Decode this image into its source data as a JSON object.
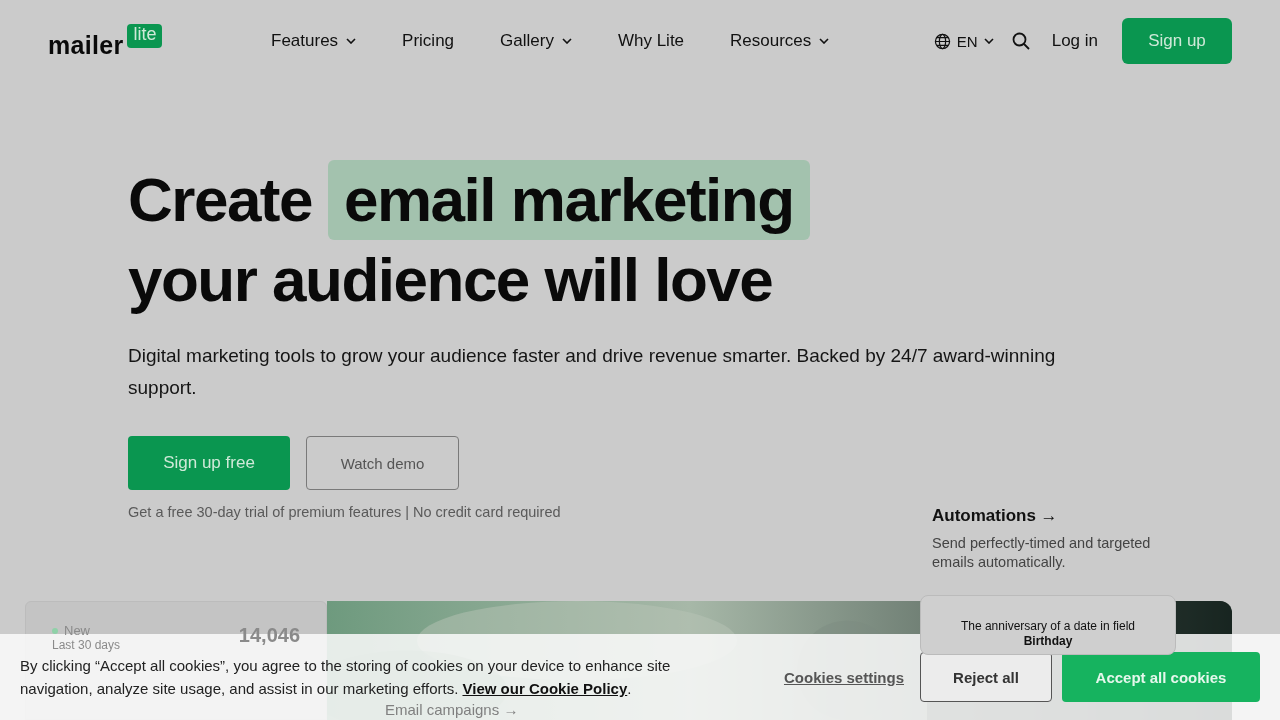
{
  "nav": {
    "logo": {
      "word": "mailer",
      "badge": "lite"
    },
    "items": [
      {
        "label": "Features",
        "dropdown": true
      },
      {
        "label": "Pricing",
        "dropdown": false
      },
      {
        "label": "Gallery",
        "dropdown": true
      },
      {
        "label": "Why Lite",
        "dropdown": false
      },
      {
        "label": "Resources",
        "dropdown": true
      }
    ],
    "language": "EN",
    "login": "Log in",
    "signup": "Sign up"
  },
  "hero": {
    "title_start": "Create",
    "title_highlight": "email marketing",
    "title_end": "your audience will love",
    "subtitle": "Digital marketing tools to grow your audience faster and drive revenue smarter. Backed by 24/7 award-winning support.",
    "primary_button": "Sign up free",
    "secondary_button": "Watch demo",
    "note": "Get a free 30-day trial of premium features | No credit card required"
  },
  "feature": {
    "title": "Automations →",
    "description": "Send perfectly-timed and targeted emails automatically."
  },
  "stats_card": {
    "label": "New",
    "period": "Last 30 days",
    "value": "14,046"
  },
  "showcase_link": "Email campaigns →",
  "automation_card": {
    "text": "The anniversary of a date in field **Birthday**"
  },
  "cookie_banner": {
    "text": "By clicking “Accept all cookies”, you agree to the storing of cookies on your device to enhance site navigation, analyze site usage, and assist in our marketing efforts.",
    "policy_link": "View our Cookie Policy",
    "policy_suffix": ".",
    "settings": "Cookies settings",
    "reject": "Reject all",
    "accept": "Accept all cookies"
  }
}
